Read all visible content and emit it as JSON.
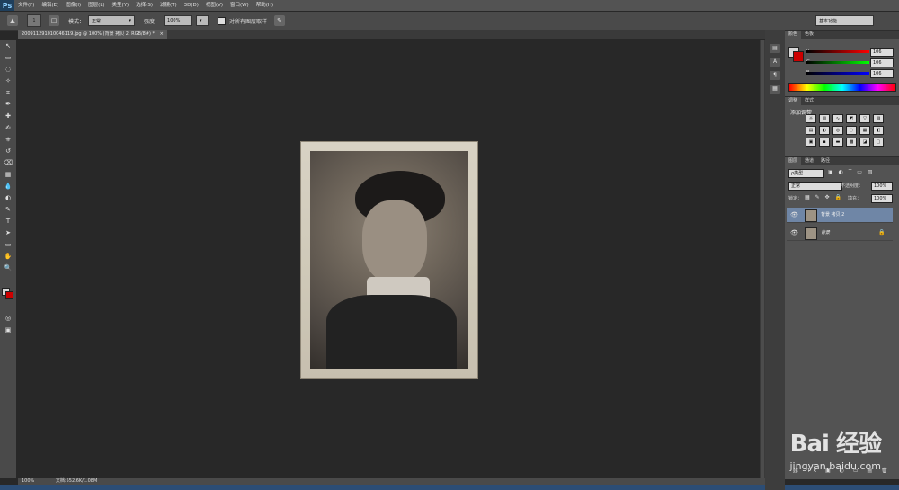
{
  "menubar": {
    "items": [
      "文件(F)",
      "编辑(E)",
      "图像(I)",
      "图层(L)",
      "类型(Y)",
      "选择(S)",
      "滤镜(T)",
      "3D(D)",
      "视图(V)",
      "窗口(W)",
      "帮助(H)"
    ],
    "logo": "Ps"
  },
  "options": {
    "mode_label": "模式：",
    "mode_value": "正常",
    "strength_label": "强度：",
    "strength_value": "100%",
    "sample_all_label": "对所有图层取样",
    "workspace_value": "基本功能",
    "brush_size": "1"
  },
  "document": {
    "tab_title": "200911291010046119.jpg @ 100% (背景 拷贝 2, RGB/8#) *"
  },
  "status": {
    "zoom": "100%",
    "doc_info": "文档:552.6K/1.08M"
  },
  "panels": {
    "color": {
      "tabs": [
        "颜色",
        "色板"
      ],
      "labels": [
        "R",
        "G",
        "B"
      ],
      "values": [
        "106",
        "106",
        "106"
      ]
    },
    "adjustments": {
      "tabs": [
        "调整",
        "样式"
      ],
      "title": "添加调整"
    },
    "layers": {
      "tabs": [
        "图层",
        "通道",
        "路径"
      ],
      "filter": "ρ类型",
      "blend_mode": "正常",
      "opacity_label": "不透明度：",
      "opacity_value": "100%",
      "lock_label": "锁定：",
      "fill_label": "填充：",
      "fill_value": "100%",
      "layers": [
        {
          "name": "背景 拷贝 2",
          "selected": true
        },
        {
          "name": "背景",
          "selected": false
        }
      ]
    }
  },
  "watermark": {
    "brand": "Bai",
    "brand_suffix": "经验",
    "url": "jingyan.baidu.com"
  },
  "colors": {
    "accent_selected": "#6f86a6",
    "foreground_swatch": "#cc0000",
    "background_swatch": "#d8d8d8"
  }
}
